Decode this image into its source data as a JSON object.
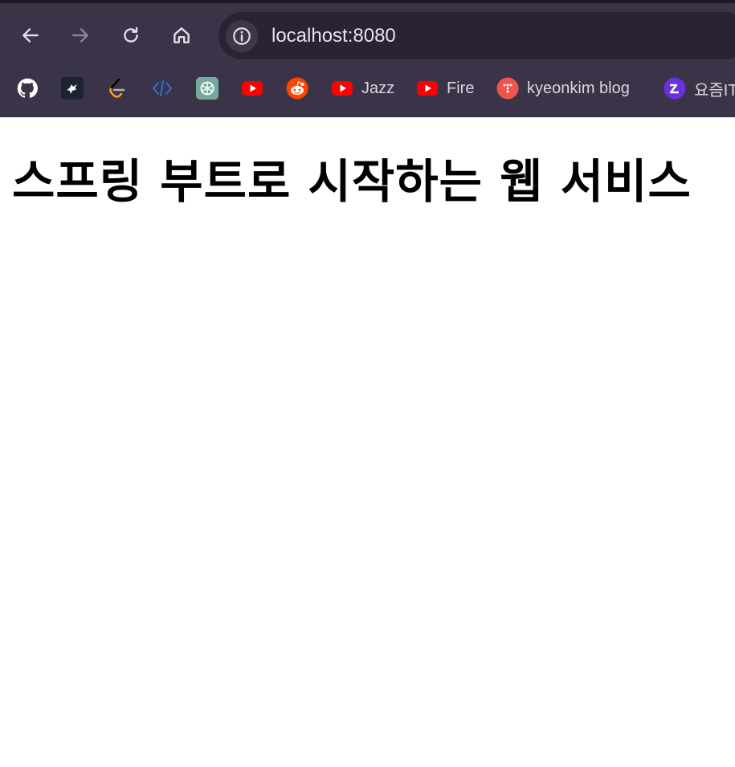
{
  "browser": {
    "url": "localhost:8080",
    "nav_buttons": [
      "back",
      "forward",
      "reload",
      "home"
    ],
    "bookmarks": [
      {
        "icon": "github-icon",
        "label": ""
      },
      {
        "icon": "bird-icon",
        "label": ""
      },
      {
        "icon": "leetcode-icon",
        "label": ""
      },
      {
        "icon": "code-brackets-icon",
        "label": ""
      },
      {
        "icon": "chatgpt-icon",
        "label": ""
      },
      {
        "icon": "youtube-icon",
        "label": ""
      },
      {
        "icon": "reddit-icon",
        "label": ""
      },
      {
        "icon": "youtube-icon",
        "label": "Jazz"
      },
      {
        "icon": "youtube-icon",
        "label": "Fire"
      },
      {
        "icon": "dots-icon",
        "label": "kyeonkim blog"
      },
      {
        "icon": "yozm-icon",
        "label": "요즘IT"
      }
    ]
  },
  "page": {
    "heading": "스프링 부트로 시작하는 웹 서비스"
  },
  "colors": {
    "chrome_bg": "#3b3347",
    "omnibox_bg": "#2a2333",
    "youtube_red": "#ff0000",
    "reddit_orange": "#ff4500"
  }
}
